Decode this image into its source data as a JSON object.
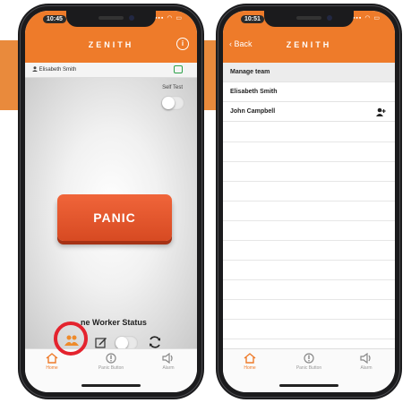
{
  "colors": {
    "brand_orange": "#ee7b2a",
    "panic_red": "#e3552a",
    "highlight_red": "#e4232e",
    "sync_green": "#2ea24a"
  },
  "left_phone": {
    "status_time": "10:45",
    "app_title": "ZENITH",
    "header_icon": "info-icon",
    "user_name": "Elisabeth Smith",
    "self_test_label": "Self Test",
    "self_test_on": false,
    "panic_label": "PANIC",
    "lone_worker_label": "ne Worker Status",
    "lone_worker_on": false,
    "tabs": [
      {
        "label": "Home",
        "icon": "home-icon",
        "active": true
      },
      {
        "label": "Panic Button",
        "icon": "alert-icon",
        "active": false
      },
      {
        "label": "Alarm",
        "icon": "speaker-icon",
        "active": false
      }
    ]
  },
  "right_phone": {
    "status_time": "10:51",
    "back_label": "Back",
    "app_title": "ZENITH",
    "section_header": "Manage team",
    "team_members": [
      {
        "name": "Elisabeth Smith"
      },
      {
        "name": "John Campbell",
        "action_icon": "add-person-icon"
      }
    ],
    "tabs": [
      {
        "label": "Home",
        "icon": "home-icon",
        "active": true
      },
      {
        "label": "Panic Button",
        "icon": "alert-icon",
        "active": false
      },
      {
        "label": "Alarm",
        "icon": "speaker-icon",
        "active": false
      }
    ]
  }
}
